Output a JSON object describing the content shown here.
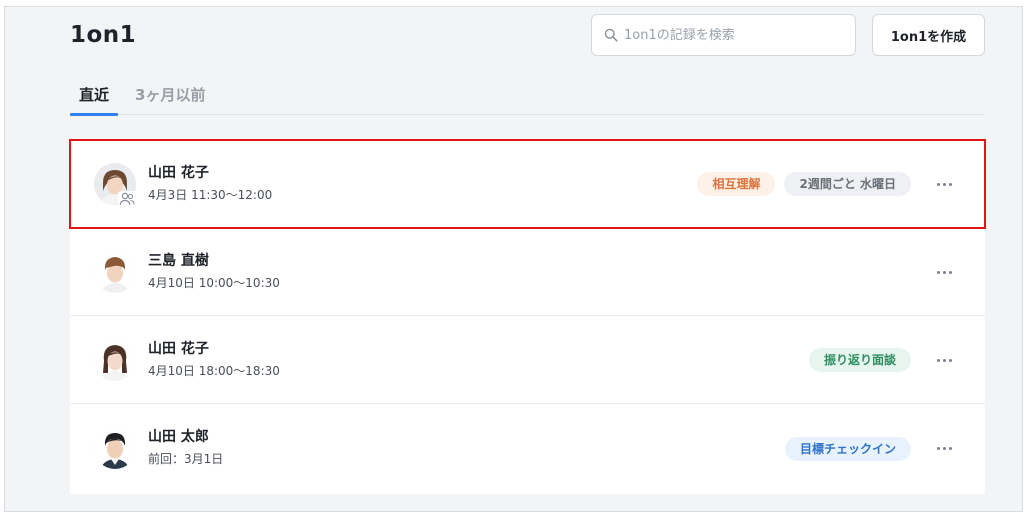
{
  "header": {
    "title": "1on1",
    "search_placeholder": "1on1の記録を検索",
    "create_button": "1on1を作成"
  },
  "tabs": [
    {
      "label": "直近",
      "active": true
    },
    {
      "label": "3ヶ月以前",
      "active": false
    }
  ],
  "records": [
    {
      "name": "山田 花子",
      "time": "4月3日 11:30〜12:00",
      "avatar": "woman-short-hair",
      "group": true,
      "selected": true,
      "tags": [
        {
          "label": "相互理解",
          "bg": "#fdf0e6",
          "fg": "#d8743c"
        },
        {
          "label": "2週間ごと 水曜日",
          "bg": "#eef0f3",
          "fg": "#6b717b"
        }
      ]
    },
    {
      "name": "三島 直樹",
      "time": "4月10日 10:00〜10:30",
      "avatar": "man-brown-hair",
      "group": false,
      "selected": false,
      "tags": []
    },
    {
      "name": "山田 花子",
      "time": "4月10日 18:00〜18:30",
      "avatar": "woman-long-hair",
      "group": false,
      "selected": false,
      "tags": [
        {
          "label": "振り返り面談",
          "bg": "#e6f6ef",
          "fg": "#2f8f62"
        }
      ]
    },
    {
      "name": "山田 太郎",
      "time": "前回：3月1日",
      "avatar": "man-dark-hair",
      "group": false,
      "selected": false,
      "tags": [
        {
          "label": "目標チェックイン",
          "bg": "#e8f2fc",
          "fg": "#2f73c9"
        }
      ]
    }
  ],
  "colors": {
    "accent": "#2f80ed",
    "selection_outline": "#e0161c"
  }
}
